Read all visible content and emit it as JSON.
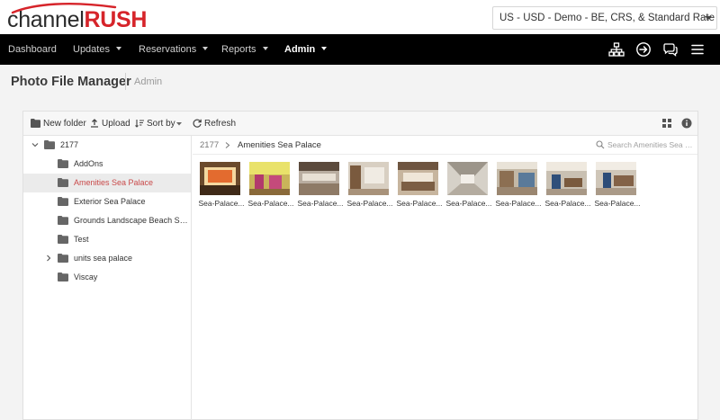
{
  "brand": {
    "part1": "channel",
    "part2": "RUSH"
  },
  "account_select": {
    "value": "US - USD - Demo - BE, CRS, & Standard Rate Plans"
  },
  "nav": {
    "items": [
      {
        "label": "Dashboard",
        "dropdown": false
      },
      {
        "label": "Updates",
        "dropdown": true
      },
      {
        "label": "Reservations",
        "dropdown": true
      },
      {
        "label": "Reports",
        "dropdown": true
      },
      {
        "label": "Admin",
        "dropdown": true,
        "active": true
      }
    ],
    "icons": [
      "sitemap-icon",
      "sign-in-icon",
      "chat-icon",
      "hamburger-menu-icon"
    ]
  },
  "page": {
    "title": "Photo File Manager",
    "crumb": "Admin"
  },
  "toolbar": {
    "new_folder": "New folder",
    "upload": "Upload",
    "sort_by": "Sort by",
    "refresh": "Refresh"
  },
  "tree": {
    "root": "2177",
    "folders": [
      {
        "label": "AddOns"
      },
      {
        "label": "Amenities Sea Palace",
        "selected": true
      },
      {
        "label": "Exterior Sea Palace"
      },
      {
        "label": "Grounds Landscape Beach Sea Pa..."
      },
      {
        "label": "Test"
      },
      {
        "label": "units sea palace",
        "expandable": true
      },
      {
        "label": "Viscay"
      }
    ]
  },
  "pane": {
    "crumb_root": "2177",
    "crumb_current": "Amenities Sea Palace",
    "search_placeholder": "Search Amenities Sea P...",
    "files": [
      {
        "caption": "Sea-Palace..."
      },
      {
        "caption": "Sea-Palace..."
      },
      {
        "caption": "Sea-Palace..."
      },
      {
        "caption": "Sea-Palace..."
      },
      {
        "caption": "Sea-Palace..."
      },
      {
        "caption": "Sea-Palace..."
      },
      {
        "caption": "Sea-Palace..."
      },
      {
        "caption": "Sea-Palace..."
      },
      {
        "caption": "Sea-Palace..."
      }
    ]
  },
  "colors": {
    "brand_red": "#d6242a",
    "navbar": "#000000",
    "selected_text": "#c94a4a"
  }
}
